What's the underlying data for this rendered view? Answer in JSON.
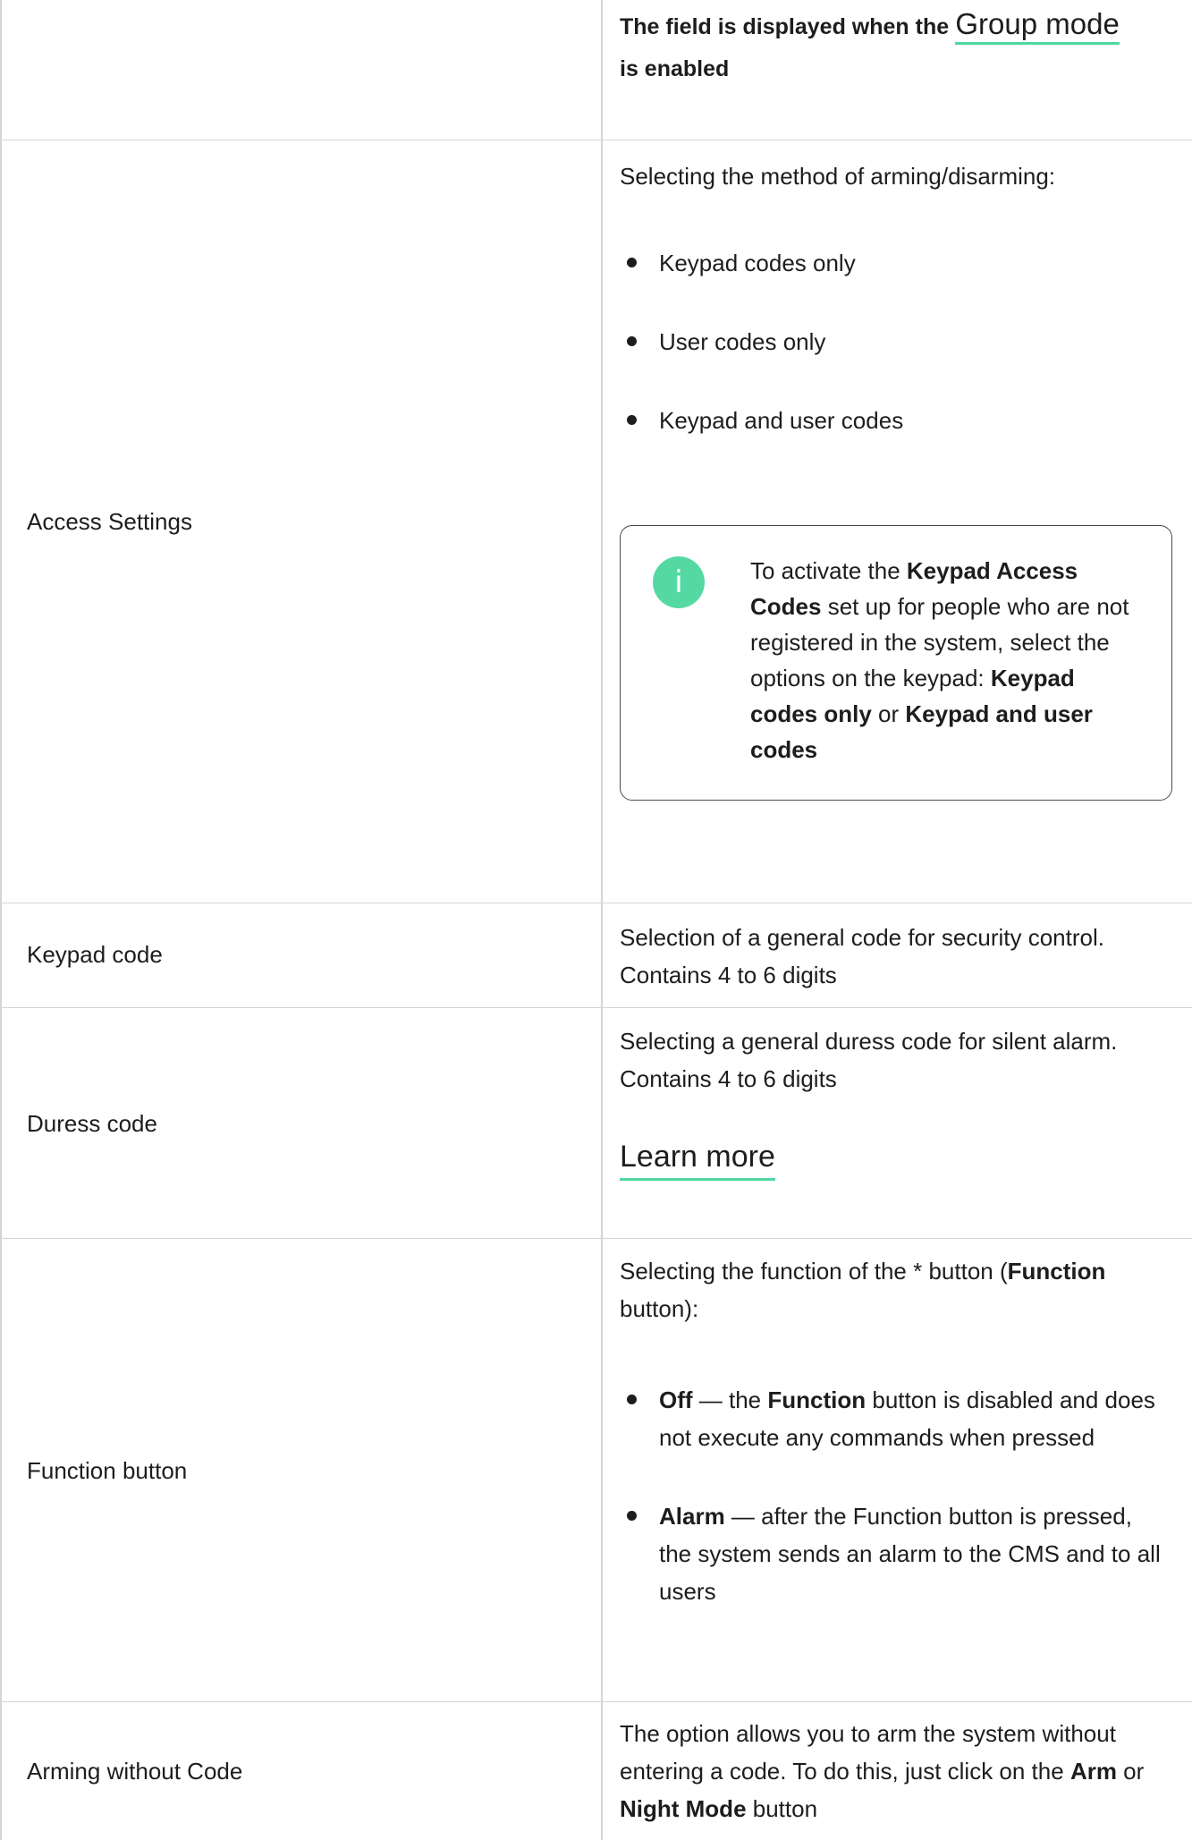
{
  "row0": {
    "right_bold": "The field is displayed when the",
    "link": "Group mode",
    "right_bold_2": "is enabled"
  },
  "row_access": {
    "label": "Access Settings",
    "intro": "Selecting the method of arming/disarming:",
    "items": [
      "Keypad codes only",
      "User codes only",
      "Keypad and user codes"
    ],
    "note": {
      "icon": "info-icon",
      "t1": "To activate the ",
      "b1": "Keypad Access Codes",
      "t2": " set up for people who are not registered in the system, select the options on the keypad: ",
      "b2": "Keypad codes only",
      "t3": " or ",
      "b3": "Keypad and user codes"
    }
  },
  "row_keypad": {
    "label": "Keypad code",
    "desc": "Selection of a general code for security control. Contains 4 to 6 digits"
  },
  "row_duress": {
    "label": "Duress code",
    "desc": "Selecting a general duress code for silent alarm. Contains 4 to 6 digits",
    "link": "Learn more"
  },
  "row_function": {
    "label": "Function button",
    "intro_1": "Selecting the function of the * button (",
    "intro_b": "Function",
    "intro_2": " button):",
    "item1_b": "Off",
    "item1_1": " — the ",
    "item1_b2": "Function",
    "item1_2": " button is disabled and does not execute any commands when pressed",
    "item2_b": "Alarm",
    "item2_1": " — after the Function button is pressed, the system sends an alarm to the CMS and to all users"
  },
  "row_arming": {
    "label": "Arming without Code",
    "t1": "The option allows you to arm the system without entering a code. To do this, just click on the ",
    "b1": "Arm",
    "t2": " or ",
    "b2": "Night Mode",
    "t3": " button"
  },
  "colors": {
    "accent": "#4fd6a0",
    "border": "#d4d4d4"
  }
}
